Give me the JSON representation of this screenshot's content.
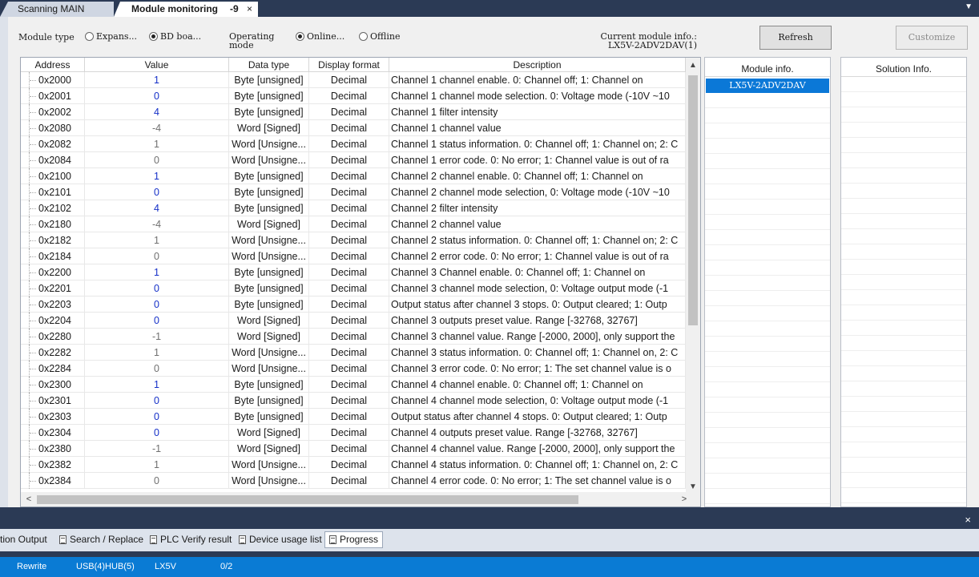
{
  "tabs": {
    "inactive_label": "Scanning MAIN",
    "active_label": "Module monitoring",
    "active_suffix": "-9",
    "close_glyph": "×",
    "menu_glyph": "▼"
  },
  "toolbar": {
    "module_type_label": "Module type",
    "module_type_options": [
      "Expans...",
      "BD boa..."
    ],
    "module_type_selected": "BD boa...",
    "operating_mode_label": "Operating mode",
    "operating_mode_options": [
      "Online...",
      "Offline"
    ],
    "operating_mode_selected": "Online...",
    "current_module_label": "Current module info.:",
    "current_module_value": "LX5V-2ADV2DAV(1)",
    "refresh_label": "Refresh",
    "customize_label": "Customize"
  },
  "grid": {
    "columns": [
      "Address",
      "Value",
      "Data type",
      "Display format",
      "Description"
    ],
    "rows": [
      {
        "address": "0x2000",
        "value": "1",
        "value_color": "blue",
        "type": "Byte [unsigned]",
        "format": "Decimal",
        "desc": "Channel 1 channel enable. 0: Channel off; 1: Channel on"
      },
      {
        "address": "0x2001",
        "value": "0",
        "value_color": "blue",
        "type": "Byte [unsigned]",
        "format": "Decimal",
        "desc": "Channel 1 channel mode selection. 0: Voltage mode (-10V ~10"
      },
      {
        "address": "0x2002",
        "value": "4",
        "value_color": "blue",
        "type": "Byte [unsigned]",
        "format": "Decimal",
        "desc": "Channel 1 filter intensity"
      },
      {
        "address": "0x2080",
        "value": "-4",
        "value_color": "gray",
        "type": "Word [Signed]",
        "format": "Decimal",
        "desc": "Channel 1 channel value"
      },
      {
        "address": "0x2082",
        "value": "1",
        "value_color": "gray",
        "type": "Word [Unsigne...",
        "format": "Decimal",
        "desc": "Channel 1 status information. 0: Channel off; 1: Channel on; 2: C"
      },
      {
        "address": "0x2084",
        "value": "0",
        "value_color": "gray",
        "type": "Word [Unsigne...",
        "format": "Decimal",
        "desc": "Channel 1 error code. 0: No error; 1: Channel value is out of ra"
      },
      {
        "address": "0x2100",
        "value": "1",
        "value_color": "blue",
        "type": "Byte [unsigned]",
        "format": "Decimal",
        "desc": "Channel 2 channel enable. 0: Channel off; 1: Channel on"
      },
      {
        "address": "0x2101",
        "value": "0",
        "value_color": "blue",
        "type": "Byte [unsigned]",
        "format": "Decimal",
        "desc": "Channel 2 channel mode selection, 0: Voltage mode (-10V ~10"
      },
      {
        "address": "0x2102",
        "value": "4",
        "value_color": "blue",
        "type": "Byte [unsigned]",
        "format": "Decimal",
        "desc": "Channel 2 filter intensity"
      },
      {
        "address": "0x2180",
        "value": "-4",
        "value_color": "gray",
        "type": "Word [Signed]",
        "format": "Decimal",
        "desc": "Channel 2 channel value"
      },
      {
        "address": "0x2182",
        "value": "1",
        "value_color": "gray",
        "type": "Word [Unsigne...",
        "format": "Decimal",
        "desc": "Channel 2 status information. 0: Channel off; 1: Channel on; 2: C"
      },
      {
        "address": "0x2184",
        "value": "0",
        "value_color": "gray",
        "type": "Word [Unsigne...",
        "format": "Decimal",
        "desc": "Channel 2 error code. 0: No error; 1: Channel value is out of ra"
      },
      {
        "address": "0x2200",
        "value": "1",
        "value_color": "blue",
        "type": "Byte [unsigned]",
        "format": "Decimal",
        "desc": "Channel 3 Channel enable. 0: Channel off; 1: Channel on"
      },
      {
        "address": "0x2201",
        "value": "0",
        "value_color": "blue",
        "type": "Byte [unsigned]",
        "format": "Decimal",
        "desc": "Channel 3 channel mode selection, 0: Voltage output mode (-1"
      },
      {
        "address": "0x2203",
        "value": "0",
        "value_color": "blue",
        "type": "Byte [unsigned]",
        "format": "Decimal",
        "desc": "Output status after channel 3 stops. 0: Output cleared; 1: Outp"
      },
      {
        "address": "0x2204",
        "value": "0",
        "value_color": "blue",
        "type": "Word [Signed]",
        "format": "Decimal",
        "desc": "Channel 3 outputs preset value. Range [-32768, 32767]"
      },
      {
        "address": "0x2280",
        "value": "-1",
        "value_color": "gray",
        "type": "Word [Signed]",
        "format": "Decimal",
        "desc": "Channel 3 channel value. Range [-2000, 2000], only support the"
      },
      {
        "address": "0x2282",
        "value": "1",
        "value_color": "gray",
        "type": "Word [Unsigne...",
        "format": "Decimal",
        "desc": "Channel 3 status information. 0: Channel off; 1: Channel on, 2: C"
      },
      {
        "address": "0x2284",
        "value": "0",
        "value_color": "gray",
        "type": "Word [Unsigne...",
        "format": "Decimal",
        "desc": "Channel 3 error code. 0: No error; 1: The set channel value is o"
      },
      {
        "address": "0x2300",
        "value": "1",
        "value_color": "blue",
        "type": "Byte [unsigned]",
        "format": "Decimal",
        "desc": "Channel 4 channel enable. 0: Channel off; 1: Channel on"
      },
      {
        "address": "0x2301",
        "value": "0",
        "value_color": "blue",
        "type": "Byte [unsigned]",
        "format": "Decimal",
        "desc": "Channel 4 channel mode selection, 0: Voltage output mode (-1"
      },
      {
        "address": "0x2303",
        "value": "0",
        "value_color": "blue",
        "type": "Byte [unsigned]",
        "format": "Decimal",
        "desc": "Output status after channel 4 stops. 0: Output cleared; 1: Outp"
      },
      {
        "address": "0x2304",
        "value": "0",
        "value_color": "blue",
        "type": "Word [Signed]",
        "format": "Decimal",
        "desc": "Channel 4 outputs preset value. Range [-32768, 32767]"
      },
      {
        "address": "0x2380",
        "value": "-1",
        "value_color": "gray",
        "type": "Word [Signed]",
        "format": "Decimal",
        "desc": "Channel 4 channel value. Range [-2000, 2000], only support the"
      },
      {
        "address": "0x2382",
        "value": "1",
        "value_color": "gray",
        "type": "Word [Unsigne...",
        "format": "Decimal",
        "desc": "Channel 4 status information. 0: Channel off; 1: Channel on, 2: C"
      },
      {
        "address": "0x2384",
        "value": "0",
        "value_color": "gray",
        "type": "Word [Unsigne...",
        "format": "Decimal",
        "desc": "Channel 4 error code. 0: No error; 1: The set channel value is o"
      }
    ]
  },
  "module_info": {
    "title": "Module info.",
    "items": [
      "LX5V-2ADV2DAV"
    ],
    "selected": "LX5V-2ADV2DAV"
  },
  "solution_info": {
    "title": "Solution Info."
  },
  "dock": {
    "close_glyph": "×",
    "tabs": [
      "tion Output",
      "Search / Replace",
      "PLC Verify result",
      "Device usage list",
      "Progress"
    ],
    "active_tab": "Progress"
  },
  "status_bar": {
    "mode": "Rewrite",
    "connection": "USB(4)HUB(5)",
    "plc": "LX5V",
    "progress": "0/2"
  },
  "colors": {
    "accent": "#0a7bd4",
    "value_blue": "#1530c8",
    "value_gray": "#707070",
    "dark_frame": "#2b3a55"
  }
}
